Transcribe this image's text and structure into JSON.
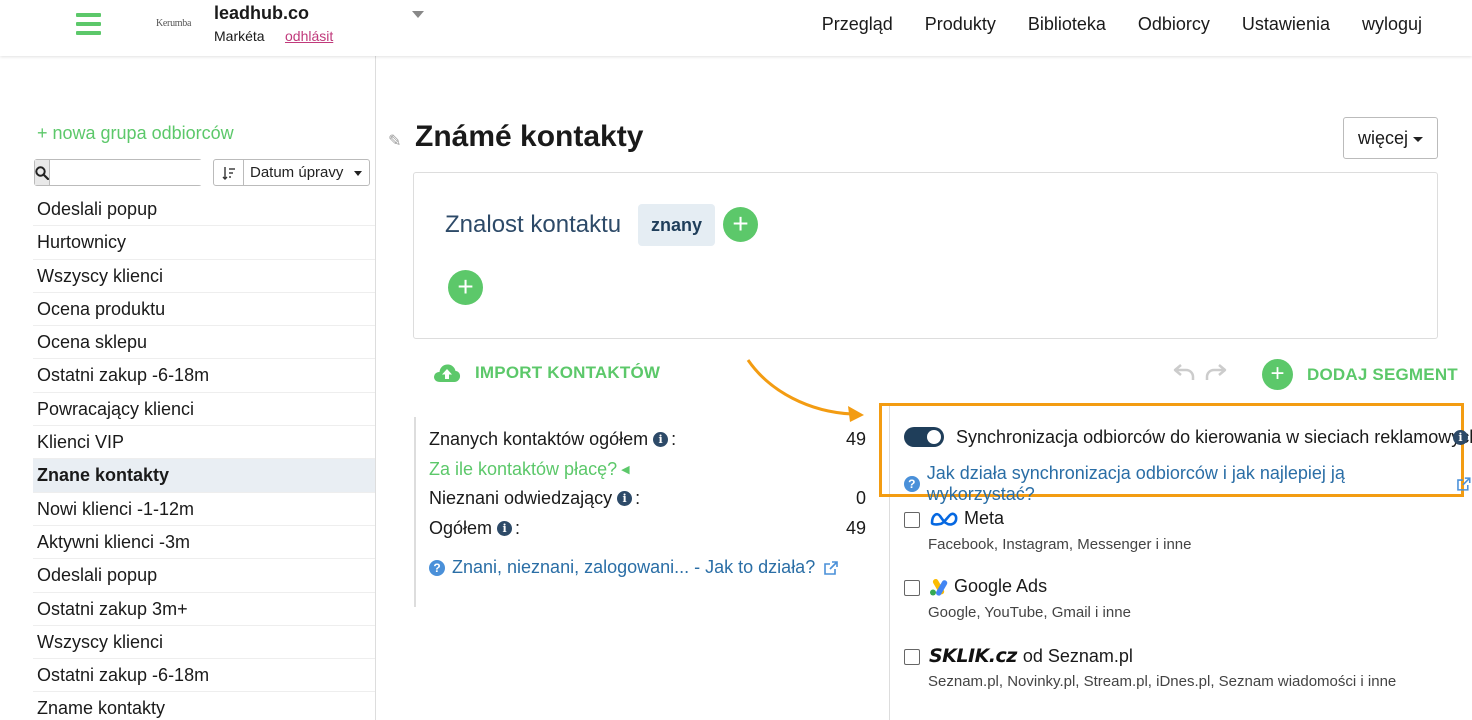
{
  "header": {
    "brand_small": "Kerumba",
    "account_name": "leadhub.co",
    "user_name": "Markéta",
    "logout_small": "odhlásit",
    "nav": [
      "Przegląd",
      "Produkty",
      "Biblioteka",
      "Odbiorcy",
      "Ustawienia",
      "wyloguj"
    ]
  },
  "sidebar": {
    "new_group": "+ nowa grupa odbiorców",
    "search_placeholder": "",
    "sort_label": "Datum úpravy",
    "groups": [
      "Odeslali popup",
      "Hurtownicy",
      "Wszyscy klienci",
      "Ocena produktu",
      "Ocena sklepu",
      "Ostatni zakup -6-18m",
      "Powracający klienci",
      "Klienci VIP",
      "Znane kontakty",
      "Nowi klienci -1-12m",
      "Aktywni klienci -3m",
      "Odeslali popup",
      "Ostatni zakup 3m+",
      "Wszyscy klienci",
      "Ostatni zakup -6-18m",
      "Zname kontakty"
    ],
    "active_index": 8
  },
  "main": {
    "title": "Známé kontakty",
    "more_button": "więcej",
    "condition_label": "Znalost kontaktu",
    "condition_tag": "znany",
    "import_label": "IMPORT KONTAKTÓW",
    "add_segment_label": "DODAJ SEGMENT"
  },
  "stats": {
    "known_label": "Znanych kontaktów ogółem",
    "known_value": "49",
    "pricing_link": "Za ile kontaktów płacę?",
    "unknown_label": "Nieznani odwiedzający",
    "unknown_value": "0",
    "total_label": "Ogółem",
    "total_value": "49",
    "help_link": "Znani, nieznani, zalogowani... - Jak to działa?"
  },
  "sync": {
    "label": "Synchronizacja odbiorców do kierowania w sieciach reklamowych",
    "help_link": "Jak działa synchronizacja odbiorców i jak najlepiej ją wykorzystać?",
    "enabled": true,
    "networks": [
      {
        "name": "Meta",
        "desc": "Facebook, Instagram, Messenger i inne"
      },
      {
        "name": "Google Ads",
        "desc": "Google, YouTube, Gmail i inne"
      },
      {
        "name": "od Seznam.pl",
        "logo_text": "SKLIK.cz",
        "desc": "Seznam.pl, Novinky.pl, Stream.pl, iDnes.pl, Seznam wiadomości i inne"
      }
    ]
  },
  "colors": {
    "green": "#5cc86a",
    "highlight_orange": "#f39c12",
    "navy": "#1f3e5a",
    "link_blue": "#2a6ea6"
  }
}
